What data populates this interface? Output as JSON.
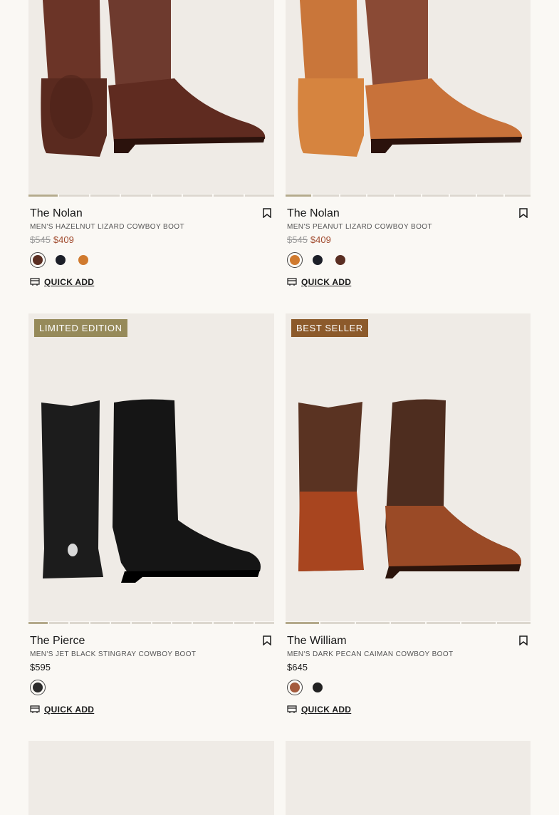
{
  "products": [
    {
      "name": "The Nolan",
      "subtitle": "Men's Hazelnut Lizard Cowboy Boot",
      "price_original": "$545",
      "price_sale": "$409",
      "badge": "",
      "swatches": [
        "#5a2e22",
        "#1c1f28",
        "#d07a2e"
      ],
      "selected_swatch": 0,
      "image_count": 8,
      "active_image": 0,
      "quick_add_label": "Quick Add"
    },
    {
      "name": "The Nolan",
      "subtitle": "Men's Peanut Lizard Cowboy Boot",
      "price_original": "$545",
      "price_sale": "$409",
      "badge": "",
      "swatches": [
        "#d07a2e",
        "#1c1f28",
        "#5a2e22"
      ],
      "selected_swatch": 0,
      "image_count": 9,
      "active_image": 0,
      "quick_add_label": "Quick Add"
    },
    {
      "name": "The Pierce",
      "subtitle": "Men's Jet Black Stingray Cowboy Boot",
      "price": "$595",
      "badge": "Limited Edition",
      "swatches": [
        "#2b2b2b"
      ],
      "selected_swatch": 0,
      "image_count": 12,
      "active_image": 0,
      "quick_add_label": "Quick Add"
    },
    {
      "name": "The William",
      "subtitle": "Men's Dark Pecan Caiman Cowboy Boot",
      "price": "$645",
      "badge": "Best Seller",
      "swatches": [
        "#a45a3c",
        "#222222"
      ],
      "selected_swatch": 0,
      "image_count": 7,
      "active_image": 0,
      "quick_add_label": "Quick Add"
    }
  ],
  "colors": {
    "background": "#faf8f4",
    "image_bg": "#efebe6",
    "sale_price": "#a04a2d",
    "badge_limited": "#968a5a",
    "badge_best": "#8c5a2b"
  },
  "icons": {
    "bookmark": "bookmark-icon",
    "quick_add": "cart-icon"
  }
}
